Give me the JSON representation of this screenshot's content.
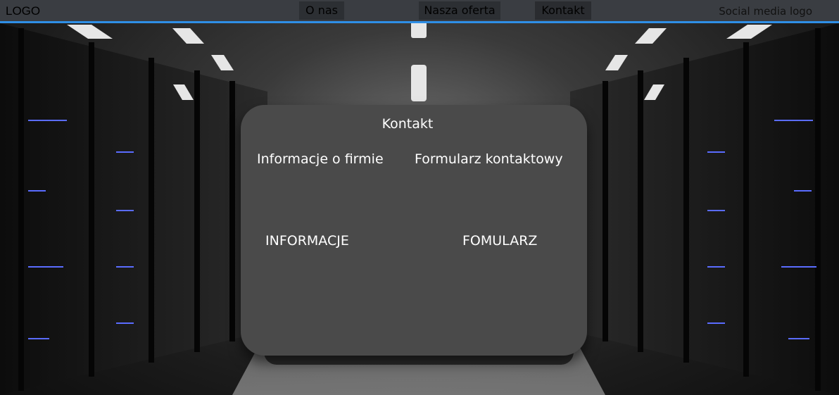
{
  "header": {
    "logo": "LOGO",
    "nav": [
      {
        "label": "O nas"
      },
      {
        "label": "Nasza oferta"
      },
      {
        "label": "Kontakt"
      }
    ],
    "social": "Social media logo",
    "accent_color": "#2f8fe6"
  },
  "contact": {
    "title": "Kontakt",
    "company_info_title": "Informacje o firmie",
    "contact_form_title": "Formularz kontaktowy",
    "company_info_body": "INFORMACJE",
    "contact_form_body": "FOMULARZ"
  }
}
